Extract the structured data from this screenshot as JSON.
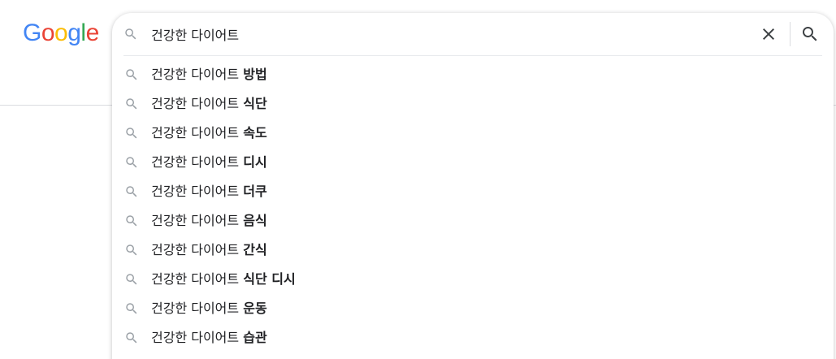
{
  "logo": {
    "text": "Google",
    "letters": [
      {
        "char": "G",
        "color": "#4285F4"
      },
      {
        "char": "o",
        "color": "#EA4335"
      },
      {
        "char": "o",
        "color": "#FBBC05"
      },
      {
        "char": "g",
        "color": "#4285F4"
      },
      {
        "char": "l",
        "color": "#34A853"
      },
      {
        "char": "e",
        "color": "#EA4335"
      }
    ]
  },
  "search": {
    "query": "건강한 다이어트",
    "search_icon": "search-icon",
    "clear_icon": "close-icon",
    "submit_icon": "search-icon"
  },
  "suggestions": [
    {
      "prefix": "건강한 다이어트 ",
      "completion": "방법"
    },
    {
      "prefix": "건강한 다이어트 ",
      "completion": "식단"
    },
    {
      "prefix": "건강한 다이어트 ",
      "completion": "속도"
    },
    {
      "prefix": "건강한 다이어트 ",
      "completion": "디시"
    },
    {
      "prefix": "건강한 다이어트 ",
      "completion": "더쿠"
    },
    {
      "prefix": "건강한 다이어트 ",
      "completion": "음식"
    },
    {
      "prefix": "건강한 다이어트 ",
      "completion": "간식"
    },
    {
      "prefix": "건강한 다이어트 ",
      "completion": "식단 디시"
    },
    {
      "prefix": "건강한 다이어트 ",
      "completion": "운동"
    },
    {
      "prefix": "건강한 다이어트 ",
      "completion": "습관"
    }
  ],
  "colors": {
    "text": "#202124",
    "icon_gray": "#9aa0a6",
    "icon_dark": "#70757a",
    "divider": "#dadce0"
  }
}
